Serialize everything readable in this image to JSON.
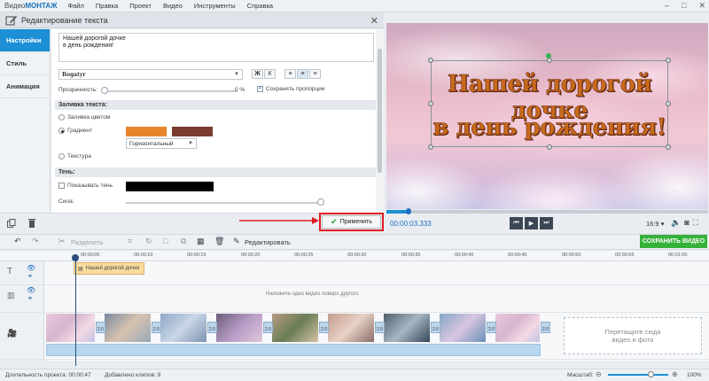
{
  "app": {
    "logo_prefix": "Видео",
    "logo_brand": "МОНТАЖ",
    "menu": [
      "Файл",
      "Правка",
      "Проект",
      "Видео",
      "Инструменты",
      "Справка"
    ],
    "window_controls": [
      "–",
      "□",
      "✕"
    ]
  },
  "editor": {
    "title": "Редактирование текста",
    "tabs": [
      "Настройки",
      "Стиль",
      "Анимация"
    ],
    "text_value": "Нашей дорогой дочке\nв день рождения!",
    "font_name": "Bogatyr",
    "opacity_label": "Прозрачность:",
    "opacity_value": "0 %",
    "opacity_level": 0,
    "keep_proportions_label": "Сохранять пропорции",
    "fill_section": "Заливка текста:",
    "fill_color_label": "Заливка цветом",
    "gradient_label": "Градиент",
    "gradient_color_1": "#e8852c",
    "gradient_color_2": "#7a3c30",
    "gradient_type": "Горизонтальный",
    "texture_label": "Текстура",
    "shadow_section": "Тень:",
    "show_shadow_label": "Показывать тень",
    "shadow_color": "#000000",
    "strength_label": "Сила:",
    "apply_label": "Применить"
  },
  "preview": {
    "line1": "Нашей дорогой дочке",
    "line2": "в день рождения!",
    "timecode": "00:00:03.333",
    "aspect": "16:9",
    "progress": 0.07
  },
  "toolbar": {
    "split_label": "Разделить",
    "edit_label": "Редактировать",
    "save_label": "СОХРАНИТЬ ВИДЕО"
  },
  "timeline": {
    "ticks": [
      "00:00:05",
      "00:00:10",
      "00:00:15",
      "00:00:20",
      "00:00:25",
      "00:00:30",
      "00:00:35",
      "00:00:40",
      "00:00:45",
      "00:00:50",
      "00:00:55",
      "00:01:00"
    ],
    "title_clip": "Нашей дорогой дочке",
    "overlay_hint": "Наложите одно видео поверх другого",
    "drop_hint_1": "Перетащите сюда",
    "drop_hint_2": "видео и фото",
    "transition_labels": [
      "2.0",
      "2.0",
      "2.0",
      "2.0",
      "2.0",
      "2.0",
      "2.0",
      "2.0",
      "2.0",
      "2.0",
      "2.0",
      "2.0"
    ]
  },
  "status": {
    "duration": "Длительность проекта:  00:00:47",
    "clips": "Добавлено клипов: 9",
    "zoom_label": "Масштаб:",
    "zoom_value": "100%"
  },
  "colors": {
    "accent": "#1d8fd6",
    "save_green": "#36b23b",
    "highlight_red": "#e11b22"
  }
}
